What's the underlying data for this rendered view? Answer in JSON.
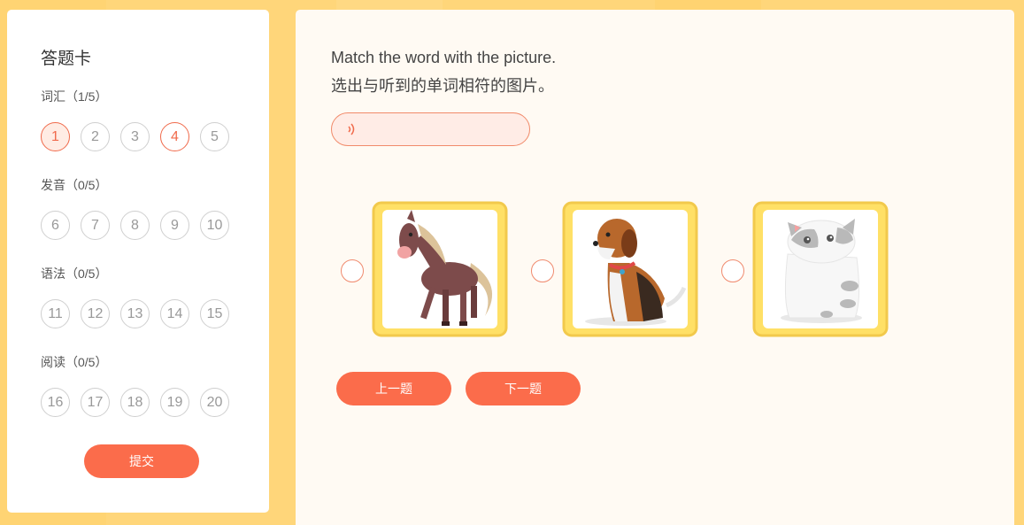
{
  "answer_card": {
    "title": "答题卡",
    "sections": [
      {
        "label": "词汇（1/5）",
        "numbers": [
          "1",
          "2",
          "3",
          "4",
          "5"
        ]
      },
      {
        "label": "发音（0/5）",
        "numbers": [
          "6",
          "7",
          "8",
          "9",
          "10"
        ]
      },
      {
        "label": "语法（0/5）",
        "numbers": [
          "11",
          "12",
          "13",
          "14",
          "15"
        ]
      },
      {
        "label": "阅读（0/5）",
        "numbers": [
          "16",
          "17",
          "18",
          "19",
          "20"
        ]
      }
    ],
    "current_question": "1",
    "answered_questions": [
      "1",
      "4"
    ],
    "submit_label": "提交"
  },
  "question": {
    "instruction_en": "Match the word with the picture.",
    "instruction_zh": "选出与听到的单词相符的图片。",
    "audio_icon": "speaker-icon",
    "options": [
      "horse",
      "dog",
      "cat"
    ],
    "prev_label": "上一题",
    "next_label": "下一题"
  },
  "colors": {
    "accent": "#fb6c4b",
    "background": "#ffd67a",
    "panel": "#fffaf3",
    "card_frame": "#ffe066"
  }
}
